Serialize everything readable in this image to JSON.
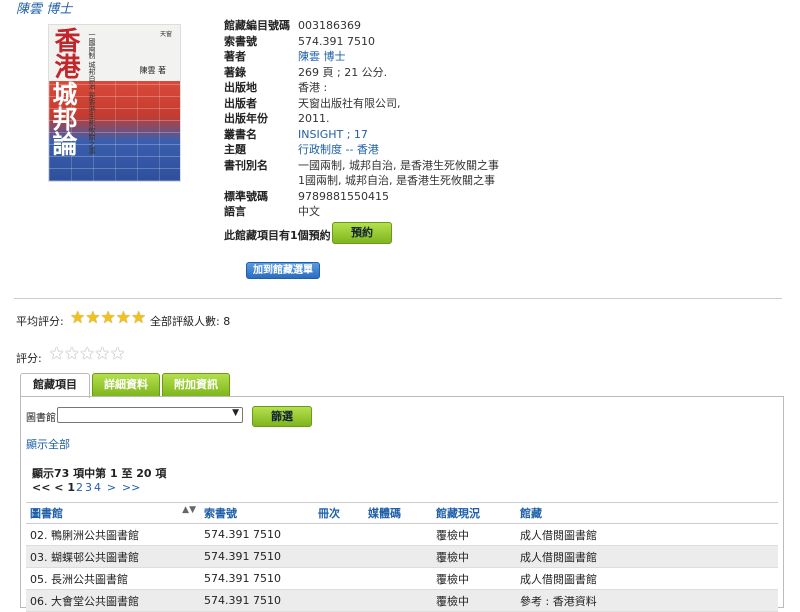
{
  "author_top": "陳雲 博士",
  "cover": {
    "title_top": "香港",
    "title_bottom": "城邦論",
    "subtitle": "一國兩制 城邦自治 是香港生死攸關之事",
    "publisher_mark": "天窗",
    "author": "陳雲 著"
  },
  "details": [
    {
      "label": "館藏編目號碼",
      "value": "003186369",
      "link": false
    },
    {
      "label": "索書號",
      "value": "574.391 7510",
      "link": false
    },
    {
      "label": "著者",
      "value": "陳雲 博士",
      "link": true
    },
    {
      "label": "著錄",
      "value": "269 頁 ; 21 公分.",
      "link": false
    },
    {
      "label": "出版地",
      "value": "香港 :",
      "link": false
    },
    {
      "label": "出版者",
      "value": "天窗出版社有限公司,",
      "link": false
    },
    {
      "label": "出版年份",
      "value": "2011.",
      "link": false
    },
    {
      "label": "叢書名",
      "value": "INSIGHT ; 17",
      "link": true
    },
    {
      "label": "主題",
      "value": "行政制度 -- 香港",
      "link": true
    },
    {
      "label": "書刊別名",
      "value": "一國兩制, 城邦自治, 是香港生死攸關之事",
      "link": false
    },
    {
      "label": "",
      "value": "1國兩制, 城邦自治, 是香港生死攸關之事",
      "link": false
    },
    {
      "label": "標準號碼",
      "value": "9789881550415",
      "link": false
    },
    {
      "label": "語言",
      "value": "中文",
      "link": false
    }
  ],
  "hold_text": "此館藏項目有1個預約",
  "reserve_label": "預約",
  "add_list_label": "加到館藏選單",
  "rating": {
    "avg_label": "平均評分:",
    "avg_stars": 5,
    "count_text": "全部評級人數: 8",
    "rate_label": "評分:",
    "user_stars": 0
  },
  "tabs": [
    "館藏項目",
    "詳細資料",
    "附加資訊"
  ],
  "filter": {
    "library_label": "圖書館",
    "selected": "",
    "button": "篩選"
  },
  "show_all": "顯示全部",
  "range_text": "顯示73 項中第 1 至 20 項",
  "pager": {
    "first": "<<",
    "prev": "<",
    "pages": [
      "1",
      "2",
      "3",
      "4"
    ],
    "current": "1",
    "next": ">",
    "last": ">>"
  },
  "table": {
    "headers": [
      "圖書館",
      "索書號",
      "冊次",
      "媒體碼",
      "館藏現況",
      "館藏"
    ],
    "rows": [
      [
        "02. 鴨脷洲公共圖書館",
        "574.391 7510",
        "",
        "",
        "覆檢中",
        "成人借閱圖書館"
      ],
      [
        "03. 蝴蝶邨公共圖書館",
        "574.391 7510",
        "",
        "",
        "覆檢中",
        "成人借閱圖書館"
      ],
      [
        "05. 長洲公共圖書館",
        "574.391 7510",
        "",
        "",
        "覆檢中",
        "成人借閱圖書館"
      ],
      [
        "06. 大會堂公共圖書館",
        "574.391 7510",
        "",
        "",
        "覆檢中",
        "參考 : 香港資料"
      ]
    ]
  },
  "colors": {
    "link": "#1f5fa8",
    "green_button": "#8cc43a",
    "star": "#f3c21a"
  }
}
